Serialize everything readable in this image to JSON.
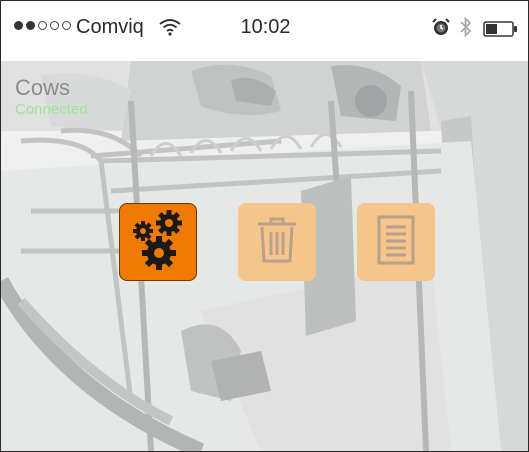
{
  "status_bar": {
    "carrier": "Comviq",
    "time": "10:02",
    "signal_strength": 2,
    "signal_max": 5,
    "icons": [
      "wifi-icon",
      "alarm-icon",
      "bluetooth-icon",
      "battery-icon"
    ]
  },
  "camera": {
    "title": "Cows",
    "status": "Connected",
    "status_color": "#9be29a"
  },
  "actions": [
    {
      "name": "settings",
      "icon": "gears-icon",
      "color": "#f07a00",
      "active": true
    },
    {
      "name": "delete",
      "icon": "trash-icon",
      "color": "#f6c58c",
      "active": false
    },
    {
      "name": "list",
      "icon": "document-list-icon",
      "color": "#f6c58c",
      "active": false
    }
  ]
}
